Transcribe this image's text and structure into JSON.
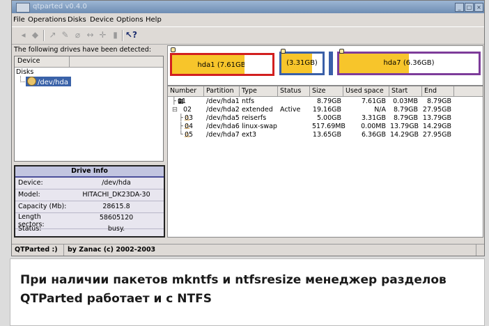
{
  "window": {
    "title": "qtparted v0.4.0"
  },
  "menu": [
    "File",
    "Operations",
    "Disks",
    "Device",
    "Options",
    "Help"
  ],
  "toolbar": [
    "back-icon",
    "forward-icon",
    "resize-icon",
    "move-icon",
    "format-icon",
    "undo-icon",
    "commit-icon",
    "delete-icon",
    "whatsthis-icon"
  ],
  "left": {
    "detected_label": "The following drives have been detected:",
    "column_header": "Device",
    "group": "Disks",
    "device": "/dev/hda"
  },
  "drive_info": {
    "title": "Drive Info",
    "rows": [
      {
        "k": "Device:",
        "v": "/dev/hda"
      },
      {
        "k": "Model:",
        "v": "HITACHI_DK23DA-30"
      },
      {
        "k": "Capacity (Mb):",
        "v": "28615.8"
      },
      {
        "k": "Length sectors:",
        "v": "58605120"
      },
      {
        "k": "Status:",
        "v": "busy."
      }
    ]
  },
  "map": {
    "p1": "hda1 (7.61GB)",
    "p2": "(3.31GB)",
    "p3": "hda7 (6.36GB)",
    "colors": {
      "ntfs": "#f7c52b",
      "extended": "#3a5fa8",
      "linux": "#7d3c9a",
      "swap": "#ffffff"
    }
  },
  "table": {
    "headers": [
      "Number",
      "Partition",
      "Type",
      "Status",
      "Size",
      "Used space",
      "Start",
      "End"
    ],
    "rows": [
      {
        "num": "01",
        "part": "/dev/hda1",
        "type": "ntfs",
        "status": "",
        "size": "8.79GB",
        "used": "7.61GB",
        "start": "0.03MB",
        "end": "8.79GB"
      },
      {
        "num": "02",
        "part": "/dev/hda2",
        "type": "extended",
        "status": "Active",
        "size": "19.16GB",
        "used": "N/A",
        "start": "8.79GB",
        "end": "27.95GB"
      },
      {
        "num": "03",
        "part": "/dev/hda5",
        "type": "reiserfs",
        "status": "",
        "size": "5.00GB",
        "used": "3.31GB",
        "start": "8.79GB",
        "end": "13.79GB"
      },
      {
        "num": "04",
        "part": "/dev/hda6",
        "type": "linux-swap",
        "status": "",
        "size": "517.69MB",
        "used": "0.00MB",
        "start": "13.79GB",
        "end": "14.29GB"
      },
      {
        "num": "05",
        "part": "/dev/hda7",
        "type": "ext3",
        "status": "",
        "size": "13.65GB",
        "used": "6.36GB",
        "start": "14.29GB",
        "end": "27.95GB"
      }
    ]
  },
  "status": {
    "app": "QTParted :)",
    "author": "by Zanac (c) 2002-2003"
  },
  "caption": {
    "line1": "При наличии пакетов mkntfs и ntfsresize менеджер разделов",
    "line2": "QTParted работает и с NTFS"
  }
}
